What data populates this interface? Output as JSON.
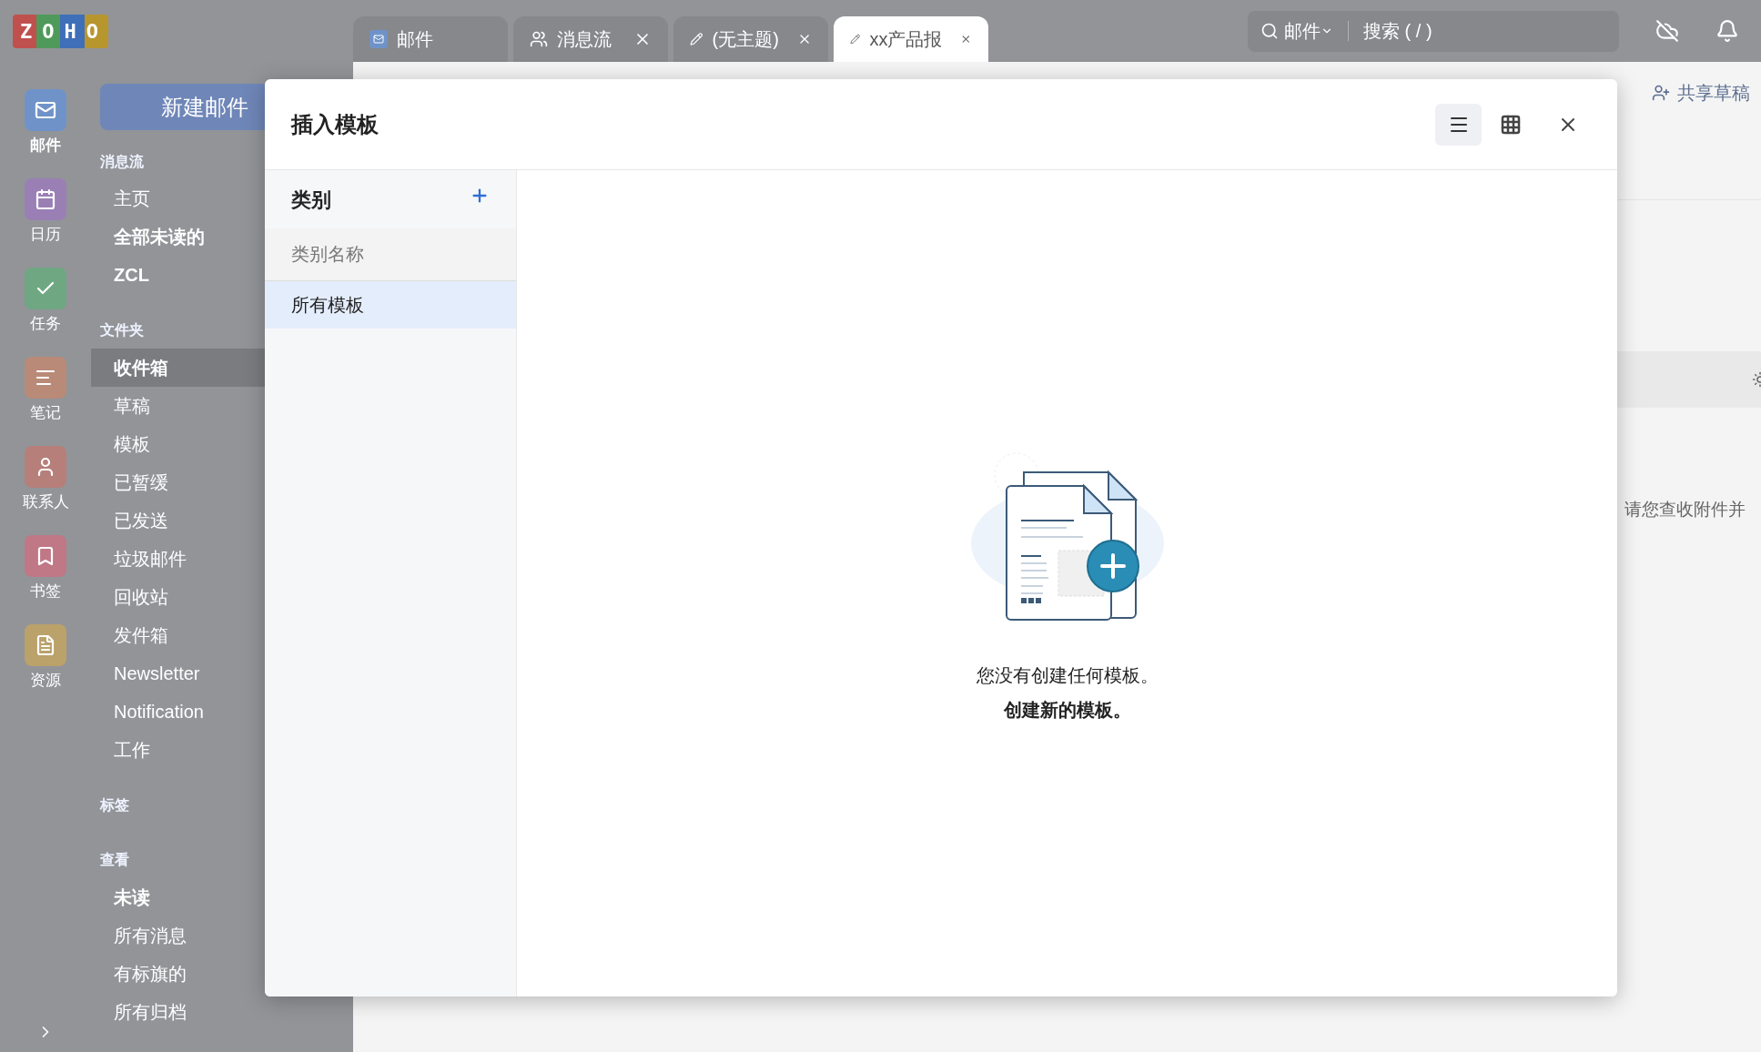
{
  "app": {
    "logo": "ZOHO"
  },
  "rail": [
    {
      "label": "邮件",
      "kind": "mail",
      "selected": true,
      "color": "#6f93c9"
    },
    {
      "label": "日历",
      "kind": "calendar",
      "selected": false,
      "color": "#9a7fb5"
    },
    {
      "label": "任务",
      "kind": "task",
      "selected": false,
      "color": "#6fa783"
    },
    {
      "label": "笔记",
      "kind": "note",
      "selected": false,
      "color": "#b98a78"
    },
    {
      "label": "联系人",
      "kind": "contact",
      "selected": false,
      "color": "#b67f7a"
    },
    {
      "label": "书签",
      "kind": "bookmark",
      "selected": false,
      "color": "#c07786"
    },
    {
      "label": "资源",
      "kind": "resource",
      "selected": false,
      "color": "#bba16a"
    }
  ],
  "sidebar": {
    "new_button": "新建邮件",
    "sections": [
      {
        "title": "消息流",
        "items": [
          {
            "label": "主页",
            "unread": false,
            "selected": false
          },
          {
            "label": "全部未读的",
            "unread": true,
            "selected": false
          },
          {
            "label": "ZCL",
            "unread": true,
            "selected": false
          }
        ]
      },
      {
        "title": "文件夹",
        "items": [
          {
            "label": "收件箱",
            "unread": true,
            "selected": true
          },
          {
            "label": "草稿",
            "unread": false,
            "selected": false
          },
          {
            "label": "模板",
            "unread": false,
            "selected": false
          },
          {
            "label": "已暂缓",
            "unread": false,
            "selected": false
          },
          {
            "label": "已发送",
            "unread": false,
            "selected": false
          },
          {
            "label": "垃圾邮件",
            "unread": false,
            "selected": false
          },
          {
            "label": "回收站",
            "unread": false,
            "selected": false
          },
          {
            "label": "发件箱",
            "unread": false,
            "selected": false
          },
          {
            "label": "Newsletter",
            "unread": false,
            "selected": false
          },
          {
            "label": "Notification",
            "unread": false,
            "selected": false
          },
          {
            "label": "工作",
            "unread": false,
            "selected": false
          }
        ]
      },
      {
        "title": "标签"
      },
      {
        "title": "查看",
        "items": [
          {
            "label": "未读",
            "unread": true,
            "selected": false
          },
          {
            "label": "所有消息",
            "unread": false,
            "selected": false
          },
          {
            "label": "有标旗的",
            "unread": false,
            "selected": false
          },
          {
            "label": "所有归档",
            "unread": false,
            "selected": false
          }
        ]
      }
    ]
  },
  "tabs": [
    {
      "label": "邮件",
      "kind": "mail",
      "closable": false,
      "selected": false
    },
    {
      "label": "消息流",
      "kind": "stream",
      "closable": true,
      "selected": false
    },
    {
      "label": "(无主题)",
      "kind": "draft",
      "closable": true,
      "selected": false
    },
    {
      "label": "xx产品报",
      "kind": "draft",
      "closable": true,
      "selected": true
    }
  ],
  "search": {
    "scope": "邮件",
    "placeholder": "搜索 ( / )"
  },
  "compose": {
    "share_button": "共享草稿",
    "body_text": "请您查收附件并"
  },
  "dialog": {
    "title": "插入模板",
    "views": [
      {
        "kind": "list",
        "selected": true
      },
      {
        "kind": "grid",
        "selected": false
      }
    ],
    "categories": {
      "title": "类别",
      "input_placeholder": "类别名称",
      "items": [
        {
          "label": "所有模板",
          "selected": true
        }
      ]
    },
    "empty": {
      "message": "您没有创建任何模板。",
      "action": "创建新的模板。"
    }
  }
}
